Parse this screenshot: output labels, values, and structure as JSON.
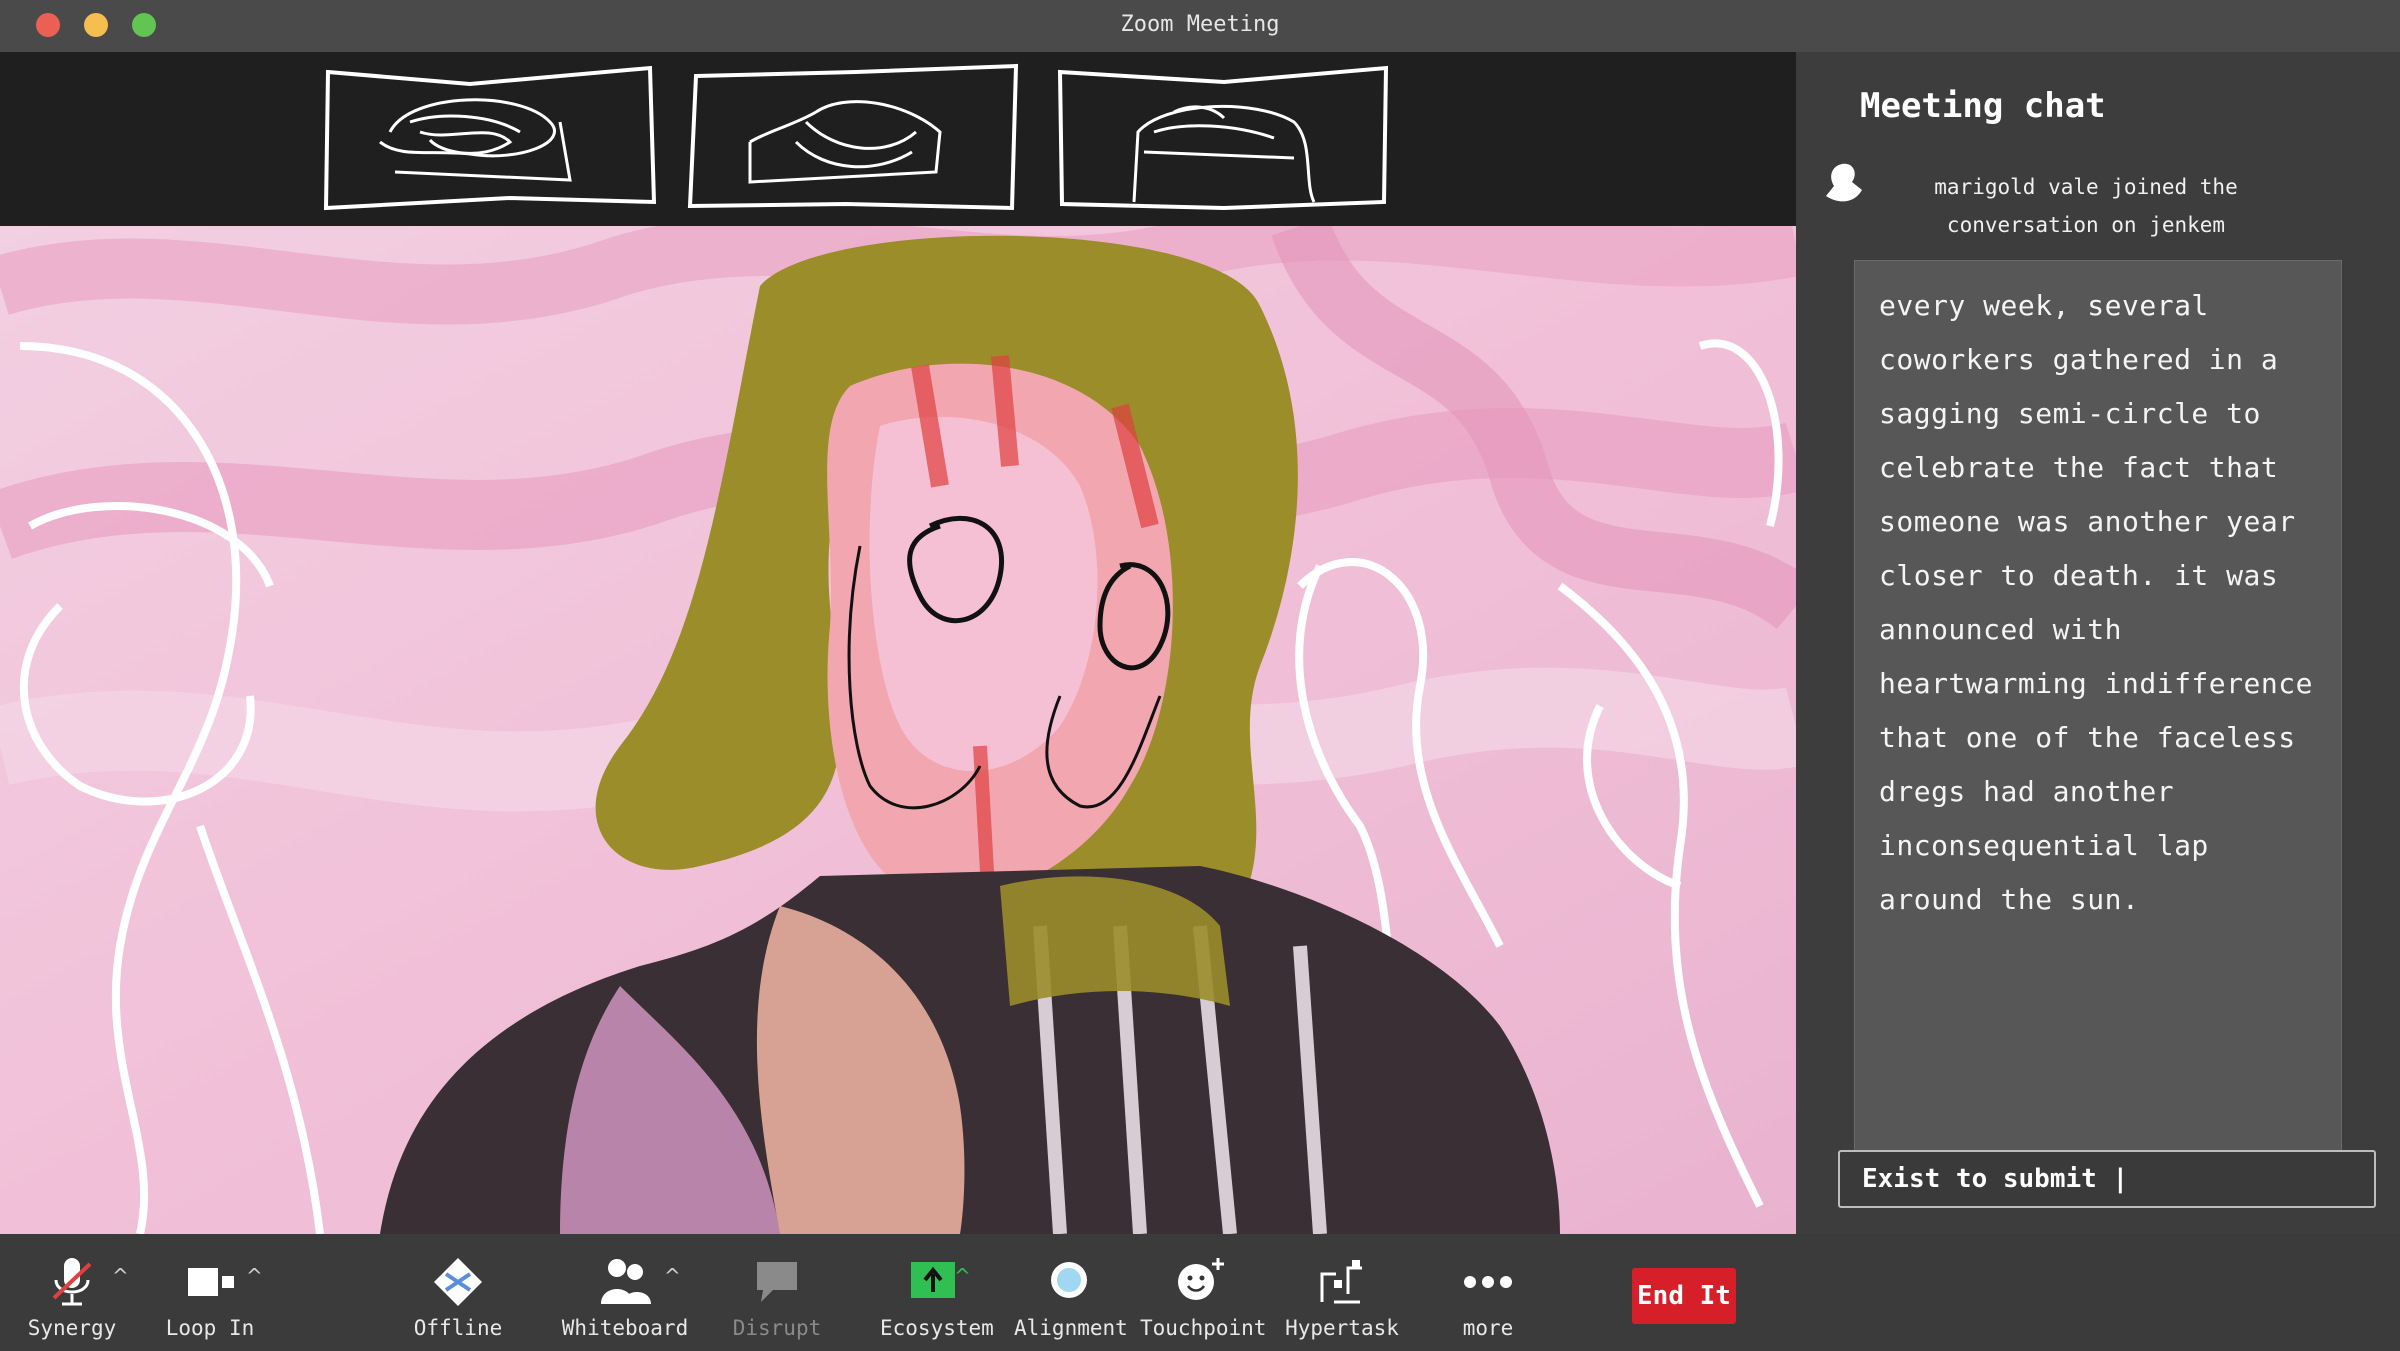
{
  "window": {
    "title": "Zoom Meeting"
  },
  "chat": {
    "title": "Meeting chat",
    "join_notice": "marigold vale joined the conversation on jenkem",
    "message": "every week, several coworkers gathered in a sagging semi-circle to celebrate the fact that someone was another year closer to death. it was announced with heartwarming indifference that one of the faceless dregs had another inconsequential lap around the sun.",
    "input_value": "Exist to submit |"
  },
  "toolbar": {
    "items": [
      {
        "label": "Synergy",
        "icon": "muted-microphone-icon"
      },
      {
        "label": "Loop In",
        "icon": "video-camera-icon"
      },
      {
        "label": "Offline",
        "icon": "diamond-icon"
      },
      {
        "label": "Whiteboard",
        "icon": "participants-icon"
      },
      {
        "label": "Disrupt",
        "icon": "speech-bubble-icon"
      },
      {
        "label": "Ecosystem",
        "icon": "share-screen-icon"
      },
      {
        "label": "Alignment",
        "icon": "bubble-icon"
      },
      {
        "label": "Touchpoint",
        "icon": "smiley-plus-icon"
      },
      {
        "label": "Hypertask",
        "icon": "apps-icon"
      },
      {
        "label": "more",
        "icon": "dots-icon"
      }
    ],
    "end_label": "End It"
  },
  "colors": {
    "accent_end": "#d71f2a",
    "share_green": "#2fbf53",
    "titlebar": "#4a4a4a",
    "panel": "#3d3d3d"
  }
}
